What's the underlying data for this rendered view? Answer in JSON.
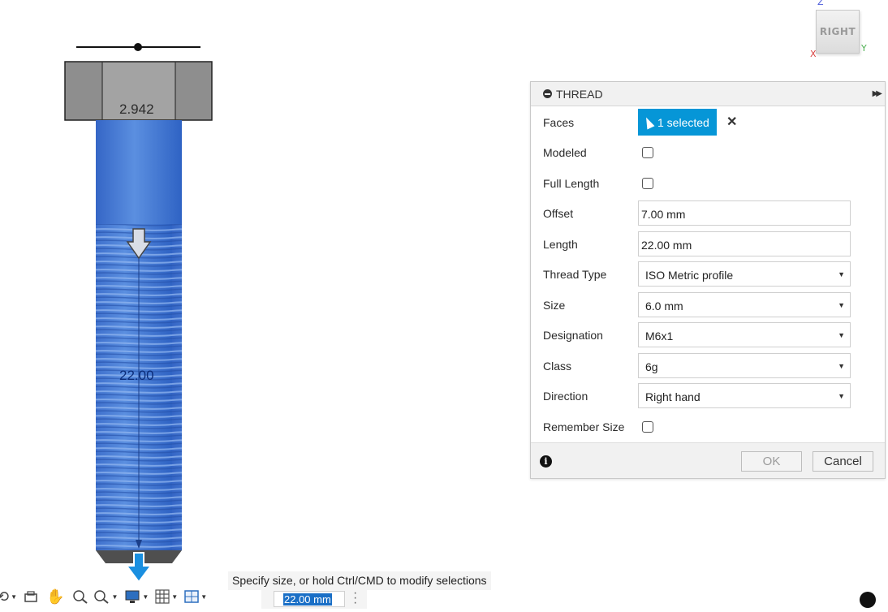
{
  "viewport": {
    "head_dimension": "2.942",
    "length_dimension": "22.00"
  },
  "viewcube": {
    "face_label": "RIGHT",
    "axis_z": "Z",
    "axis_x": "X",
    "axis_y": "Y"
  },
  "panel": {
    "title": "THREAD",
    "faces": {
      "label": "Faces",
      "button": "1 selected"
    },
    "modeled": {
      "label": "Modeled",
      "checked": false
    },
    "full_length": {
      "label": "Full Length",
      "checked": false
    },
    "offset": {
      "label": "Offset",
      "value": "7.00 mm"
    },
    "length": {
      "label": "Length",
      "value": "22.00 mm"
    },
    "thread_type": {
      "label": "Thread Type",
      "value": "ISO Metric profile"
    },
    "size": {
      "label": "Size",
      "value": "6.0 mm"
    },
    "designation": {
      "label": "Designation",
      "value": "M6x1"
    },
    "class": {
      "label": "Class",
      "value": "6g"
    },
    "direction": {
      "label": "Direction",
      "value": "Right hand"
    },
    "remember_size": {
      "label": "Remember Size",
      "checked": false
    },
    "ok_label": "OK",
    "cancel_label": "Cancel"
  },
  "bottom": {
    "hint": "Specify size, or hold Ctrl/CMD to modify selections",
    "value": "22.00 mm"
  },
  "colors": {
    "accent": "#0696d7",
    "thread_blue": "#3f7bd4",
    "bolt_head": "#8e8e8e"
  }
}
